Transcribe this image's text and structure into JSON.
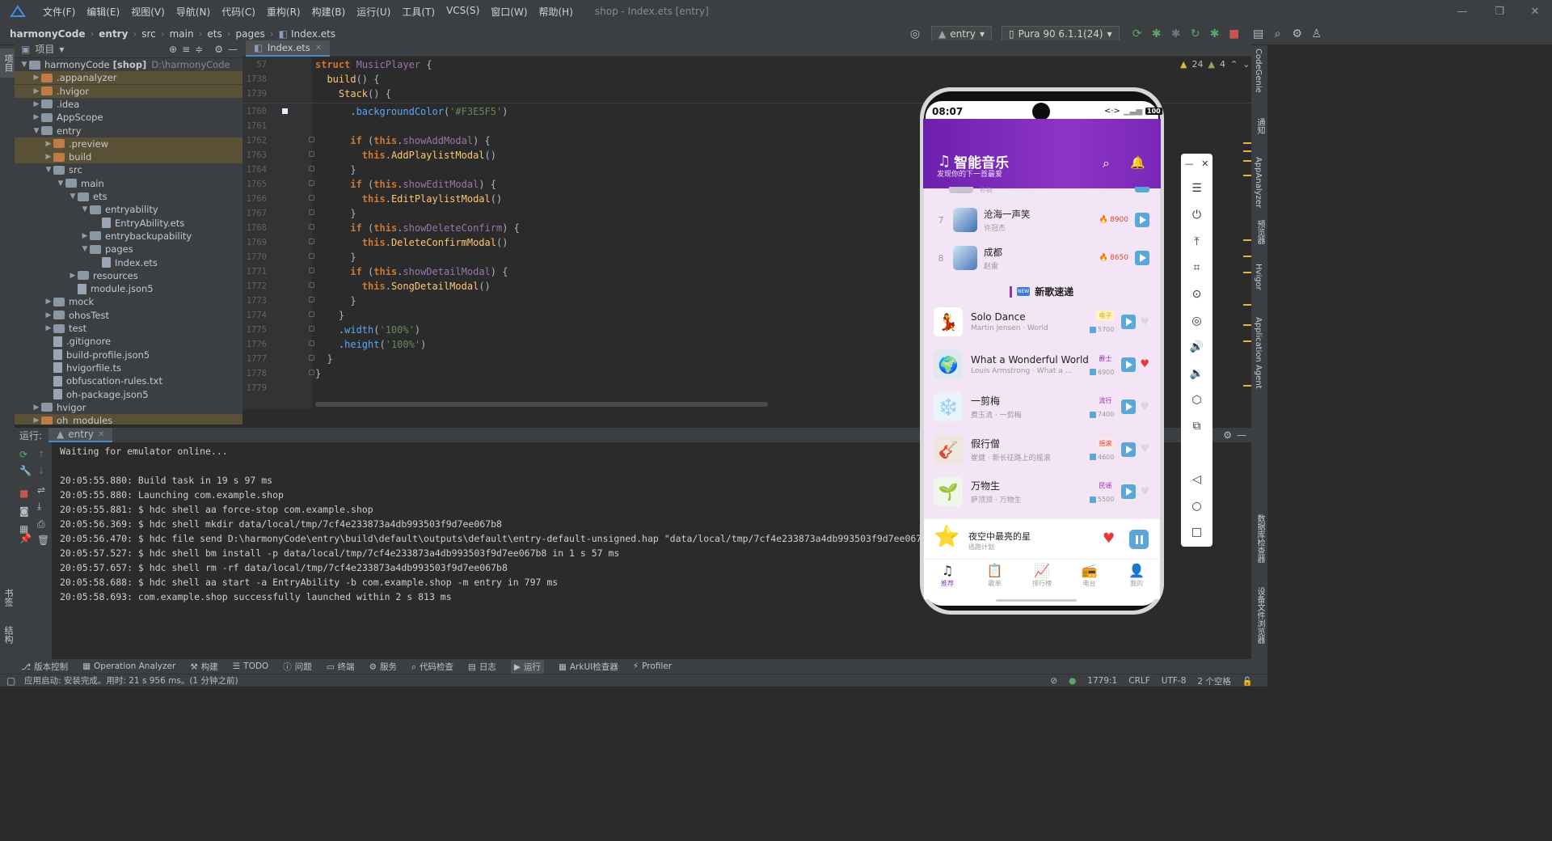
{
  "menubar": {
    "items": [
      "文件(F)",
      "编辑(E)",
      "视图(V)",
      "导航(N)",
      "代码(C)",
      "重构(R)",
      "构建(B)",
      "运行(U)",
      "工具(T)",
      "VCS(S)",
      "窗口(W)",
      "帮助(H)"
    ],
    "window_title": "shop - Index.ets [entry]"
  },
  "navbar": {
    "crumbs": [
      "harmonyCode",
      "entry",
      "src",
      "main",
      "ets",
      "pages",
      "Index.ets"
    ],
    "run_config": "entry",
    "device": "Pura 90 6.1.1(24)"
  },
  "leftstrip": {
    "tabs": [
      "项目",
      "书签",
      "结构"
    ]
  },
  "project": {
    "title": "项目",
    "tree": [
      {
        "label": "harmonyCode",
        "bold": "[shop]",
        "extra": "D:\\harmonyCode",
        "depth": 0,
        "arrow": "down",
        "icon": "folder"
      },
      {
        "label": ".appanalyzer",
        "depth": 1,
        "arrow": "right",
        "icon": "folder-orange",
        "hl": true
      },
      {
        "label": ".hvigor",
        "depth": 1,
        "arrow": "right",
        "icon": "folder-orange",
        "hl": true
      },
      {
        "label": ".idea",
        "depth": 1,
        "arrow": "right",
        "icon": "folder"
      },
      {
        "label": "AppScope",
        "depth": 1,
        "arrow": "right",
        "icon": "folder"
      },
      {
        "label": "entry",
        "depth": 1,
        "arrow": "down",
        "icon": "folder"
      },
      {
        "label": ".preview",
        "depth": 2,
        "arrow": "right",
        "icon": "folder-orange",
        "hl": true
      },
      {
        "label": "build",
        "depth": 2,
        "arrow": "right",
        "icon": "folder-orange",
        "hl": true
      },
      {
        "label": "src",
        "depth": 2,
        "arrow": "down",
        "icon": "folder"
      },
      {
        "label": "main",
        "depth": 3,
        "arrow": "down",
        "icon": "folder"
      },
      {
        "label": "ets",
        "depth": 4,
        "arrow": "down",
        "icon": "folder"
      },
      {
        "label": "entryability",
        "depth": 5,
        "arrow": "down",
        "icon": "folder"
      },
      {
        "label": "EntryAbility.ets",
        "depth": 6,
        "arrow": "",
        "icon": "file"
      },
      {
        "label": "entrybackupability",
        "depth": 5,
        "arrow": "right",
        "icon": "folder"
      },
      {
        "label": "pages",
        "depth": 5,
        "arrow": "down",
        "icon": "folder"
      },
      {
        "label": "Index.ets",
        "depth": 6,
        "arrow": "",
        "icon": "file"
      },
      {
        "label": "resources",
        "depth": 4,
        "arrow": "right",
        "icon": "folder"
      },
      {
        "label": "module.json5",
        "depth": 4,
        "arrow": "",
        "icon": "file"
      },
      {
        "label": "mock",
        "depth": 2,
        "arrow": "right",
        "icon": "folder"
      },
      {
        "label": "ohosTest",
        "depth": 2,
        "arrow": "right",
        "icon": "folder"
      },
      {
        "label": "test",
        "depth": 2,
        "arrow": "right",
        "icon": "folder"
      },
      {
        "label": ".gitignore",
        "depth": 2,
        "arrow": "",
        "icon": "file"
      },
      {
        "label": "build-profile.json5",
        "depth": 2,
        "arrow": "",
        "icon": "file"
      },
      {
        "label": "hvigorfile.ts",
        "depth": 2,
        "arrow": "",
        "icon": "file"
      },
      {
        "label": "obfuscation-rules.txt",
        "depth": 2,
        "arrow": "",
        "icon": "file"
      },
      {
        "label": "oh-package.json5",
        "depth": 2,
        "arrow": "",
        "icon": "file"
      },
      {
        "label": "hvigor",
        "depth": 1,
        "arrow": "right",
        "icon": "folder"
      },
      {
        "label": "oh_modules",
        "depth": 1,
        "arrow": "right",
        "icon": "folder-orange",
        "hl": true
      }
    ]
  },
  "editor": {
    "tab": "Index.ets",
    "inspections": {
      "warnings": "24",
      "weak": "4"
    },
    "lines": [
      {
        "n": "57",
        "code": "struct MusicPlayer {"
      },
      {
        "n": "1738",
        "code": "  build() {"
      },
      {
        "n": "1739",
        "code": "    Stack() {"
      },
      {
        "n": "1760",
        "code": "      .backgroundColor('#F3E5F5')"
      },
      {
        "n": "1761",
        "code": ""
      },
      {
        "n": "1762",
        "code": "      if (this.showAddModal) {"
      },
      {
        "n": "1763",
        "code": "        this.AddPlaylistModal()"
      },
      {
        "n": "1764",
        "code": "      }"
      },
      {
        "n": "1765",
        "code": "      if (this.showEditModal) {"
      },
      {
        "n": "1766",
        "code": "        this.EditPlaylistModal()"
      },
      {
        "n": "1767",
        "code": "      }"
      },
      {
        "n": "1768",
        "code": "      if (this.showDeleteConfirm) {"
      },
      {
        "n": "1769",
        "code": "        this.DeleteConfirmModal()"
      },
      {
        "n": "1770",
        "code": "      }"
      },
      {
        "n": "1771",
        "code": "      if (this.showDetailModal) {"
      },
      {
        "n": "1772",
        "code": "        this.SongDetailModal()"
      },
      {
        "n": "1773",
        "code": "      }"
      },
      {
        "n": "1774",
        "code": "    }"
      },
      {
        "n": "1775",
        "code": "    .width('100%')"
      },
      {
        "n": "1776",
        "code": "    .height('100%')"
      },
      {
        "n": "1777",
        "code": "  }"
      },
      {
        "n": "1778",
        "code": "}"
      },
      {
        "n": "1779",
        "code": ""
      }
    ]
  },
  "run": {
    "label": "运行:",
    "tab": "entry",
    "log": [
      "Waiting for emulator online...",
      "",
      "20:05:55.880: Build task in 19 s 97 ms",
      "20:05:55.880: Launching com.example.shop",
      "20:05:55.881: $ hdc shell aa force-stop com.example.shop",
      "20:05:56.369: $ hdc shell mkdir data/local/tmp/7cf4e233873a4db993503f9d7ee067b8",
      "20:05:56.470: $ hdc file send D:\\harmonyCode\\entry\\build\\default\\outputs\\default\\entry-default-unsigned.hap \"data/local/tmp/7cf4e233873a4db993503f9d7ee067b8\" in 10",
      "20:05:57.527: $ hdc shell bm install -p data/local/tmp/7cf4e233873a4db993503f9d7ee067b8 in 1 s 57 ms",
      "20:05:57.657: $ hdc shell rm -rf data/local/tmp/7cf4e233873a4db993503f9d7ee067b8",
      "20:05:58.688: $ hdc shell aa start -a EntryAbility -b com.example.shop -m entry in 797 ms",
      "20:05:58.693: com.example.shop successfully launched within 2 s 813 ms"
    ]
  },
  "rightstrip": {
    "tabs": [
      "CodeGenie",
      "通知",
      "AppAnalyzer",
      "预览器",
      "Hvigor",
      "Application Agent",
      "数据库检查器",
      "设备文件浏览器"
    ]
  },
  "bottombar": {
    "items": [
      "版本控制",
      "Operation Analyzer",
      "构建",
      "TODO",
      "问题",
      "终端",
      "服务",
      "代码检查",
      "日志",
      "运行",
      "ArkUI检查器",
      "Profiler"
    ]
  },
  "statusbar": {
    "message": "应用启动: 安装完成。用时: 21 s 956 ms。(1 分钟之前)",
    "position": "1779:1",
    "line_sep": "CRLF",
    "encoding": "UTF-8",
    "indent": "2 个空格"
  },
  "phone": {
    "time": "08:07",
    "battery": "100",
    "app_title": "智能音乐",
    "app_subtitle": "发现你的下一首最爱",
    "partial_sub": "朴树",
    "rank_songs": [
      {
        "rank": "7",
        "title": "沧海一声笑",
        "artist": "许冠杰",
        "heat": "8900",
        "thumb": "#3b6fb0"
      },
      {
        "rank": "8",
        "title": "成都",
        "artist": "赵雷",
        "heat": "8650",
        "thumb": "#4a78b8"
      }
    ],
    "new_section": "新歌速递",
    "new_badge": "NEW",
    "new_songs": [
      {
        "title": "Solo Dance",
        "sub": "Martin Jensen · World",
        "tag": "电子",
        "tag_bg": "#fff4c2",
        "tag_fg": "#e6a400",
        "plays": "5700",
        "liked": false
      },
      {
        "title": "What a Wonderful World",
        "sub": "Louis Armstrong · What a ...",
        "tag": "爵士",
        "tag_bg": "#f3e5f5",
        "tag_fg": "#9b27b0",
        "plays": "6900",
        "liked": true
      },
      {
        "title": "一剪梅",
        "sub": "费玉清 · 一剪梅",
        "tag": "流行",
        "tag_bg": "#f3e5f5",
        "tag_fg": "#9b27b0",
        "plays": "7400",
        "liked": false
      },
      {
        "title": "假行僧",
        "sub": "崔健 · 新长征路上的摇滚",
        "tag": "摇滚",
        "tag_bg": "#fde7e7",
        "tag_fg": "#e53935",
        "plays": "4600",
        "liked": false
      },
      {
        "title": "万物生",
        "sub": "萨顶顶 · 万物生",
        "tag": "民谣",
        "tag_bg": "#f3e5f5",
        "tag_fg": "#9b27b0",
        "plays": "5500",
        "liked": false
      }
    ],
    "now_playing": {
      "title": "夜空中最亮的星",
      "artist": "逃跑计划"
    },
    "tabs": [
      "推荐",
      "歌单",
      "排行榜",
      "电台",
      "我的"
    ]
  },
  "colors": {
    "accent": "#8c35c5",
    "play": "#5aa8d8",
    "heart": "#e53935"
  }
}
